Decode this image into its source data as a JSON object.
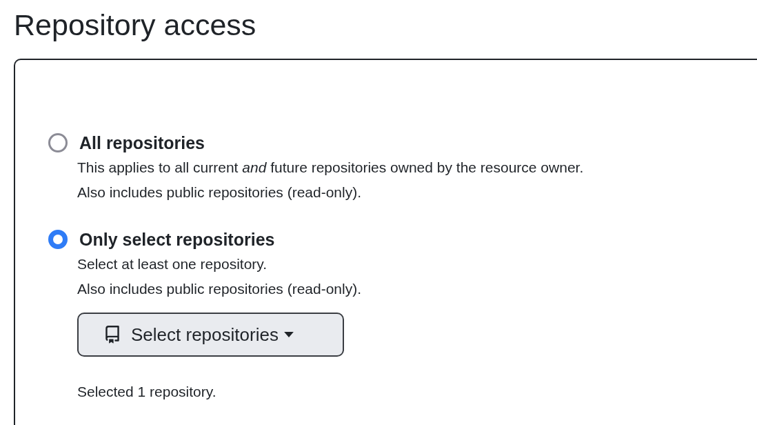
{
  "title": "Repository access",
  "options": [
    {
      "label": "All repositories",
      "selected": false,
      "description": [
        "This applies to all current *and* future repositories owned by the resource owner.",
        "Also includes public repositories (read-only)."
      ]
    },
    {
      "label": "Only select repositories",
      "selected": true,
      "description": [
        "Select at least one repository.",
        "Also includes public repositories (read-only)."
      ]
    }
  ],
  "select_button": {
    "label": "Select repositories"
  },
  "selection_summary": "Selected 1 repository."
}
